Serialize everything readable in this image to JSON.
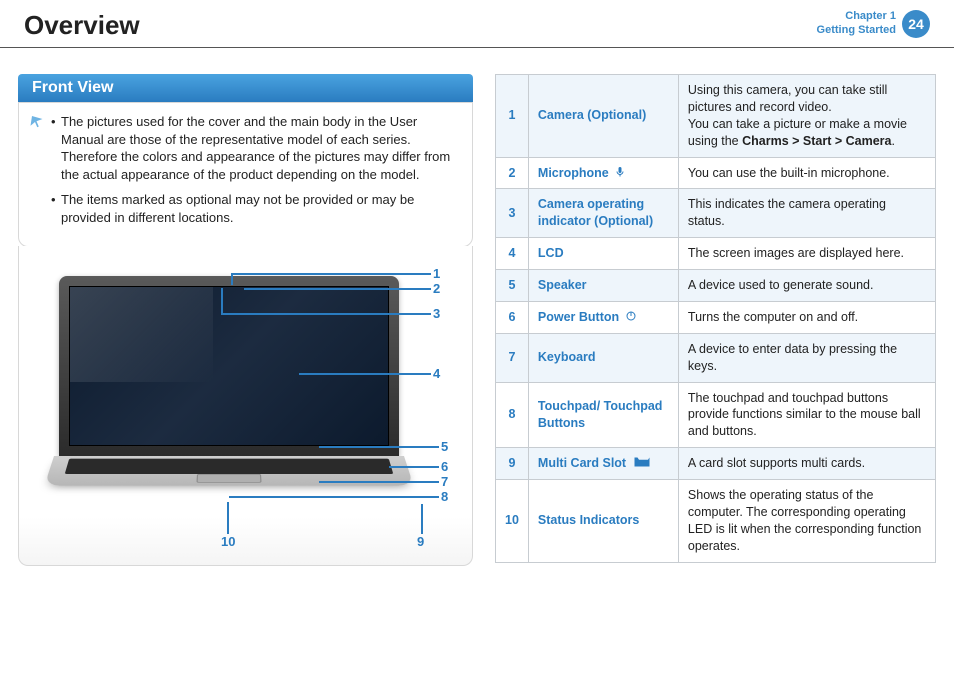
{
  "header": {
    "title": "Overview",
    "chapter_line1": "Chapter 1",
    "chapter_line2": "Getting Started",
    "page_number": "24"
  },
  "section": {
    "heading": "Front View"
  },
  "notes": {
    "item1": "The pictures used for the cover and the main body in the User Manual are those of the representative model of each series. Therefore the colors and appearance of the pictures may differ from the actual appearance of the product depending on the model.",
    "item2": "The items marked as optional may not be provided or may be provided in different locations."
  },
  "diagram_labels": {
    "n1": "1",
    "n2": "2",
    "n3": "3",
    "n4": "4",
    "n5": "5",
    "n6": "6",
    "n7": "7",
    "n8": "8",
    "n9": "9",
    "n10": "10"
  },
  "parts": [
    {
      "num": "1",
      "label": "Camera (Optional)",
      "icon": "",
      "desc_html": "Using this camera, you can take still pictures and record video.<br>You can take a picture or make a movie using the <b>Charms > Start > Camera</b>."
    },
    {
      "num": "2",
      "label": "Microphone",
      "icon": "microphone-icon",
      "desc_html": "You can use the built-in microphone."
    },
    {
      "num": "3",
      "label": "Camera operating indicator (Optional)",
      "icon": "",
      "desc_html": "This indicates the camera operating status."
    },
    {
      "num": "4",
      "label": "LCD",
      "icon": "",
      "desc_html": "The screen images are displayed here."
    },
    {
      "num": "5",
      "label": "Speaker",
      "icon": "",
      "desc_html": "A device used to generate sound."
    },
    {
      "num": "6",
      "label": "Power Button",
      "icon": "power-icon",
      "desc_html": "Turns the computer on and off."
    },
    {
      "num": "7",
      "label": "Keyboard",
      "icon": "",
      "desc_html": "A device to enter data by pressing the keys."
    },
    {
      "num": "8",
      "label": "Touchpad/ Touchpad Buttons",
      "icon": "",
      "desc_html": "The touchpad and touchpad buttons provide functions similar to the mouse ball and buttons."
    },
    {
      "num": "9",
      "label": "Multi Card Slot",
      "icon": "sd-icon",
      "desc_html": "A card slot supports multi cards."
    },
    {
      "num": "10",
      "label": "Status Indicators",
      "icon": "",
      "desc_html": "Shows the operating status of the computer. The corresponding operating LED is lit when the corresponding function operates."
    }
  ],
  "chart_data": null
}
